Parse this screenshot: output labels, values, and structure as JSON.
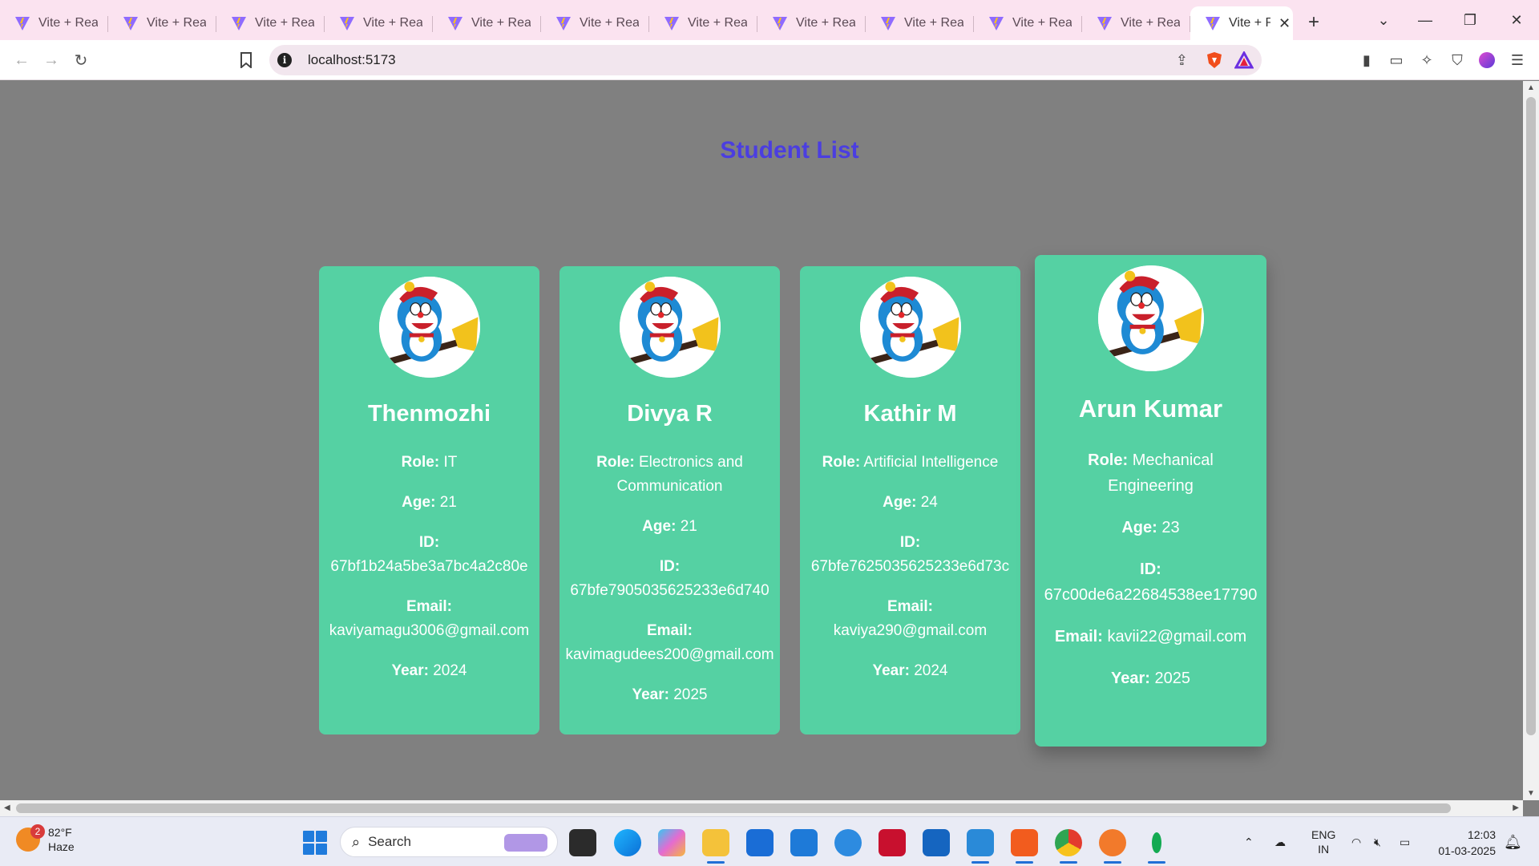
{
  "browser": {
    "tabs": [
      {
        "title": "Vite + React"
      },
      {
        "title": "Vite + React"
      },
      {
        "title": "Vite + React"
      },
      {
        "title": "Vite + React"
      },
      {
        "title": "Vite + React"
      },
      {
        "title": "Vite + React"
      },
      {
        "title": "Vite + React"
      },
      {
        "title": "Vite + React"
      },
      {
        "title": "Vite + React"
      },
      {
        "title": "Vite + React"
      },
      {
        "title": "Vite + React"
      }
    ],
    "active_tab": {
      "title": "Vite + React"
    },
    "address": "localhost:5173",
    "icons": [
      "back-icon",
      "forward-icon",
      "reload-icon",
      "bookmark-icon",
      "site-info-icon",
      "share-icon",
      "brave-shields-icon",
      "brave-rewards-icon",
      "sidebar-icon",
      "wallet-icon",
      "leo-ai-icon",
      "vpn-icon",
      "profile-icon",
      "menu-icon"
    ]
  },
  "page": {
    "heading": "Student List",
    "heading_color": "#4b3ee0",
    "card_color": "#55d1a3",
    "labels": {
      "role": "Role:",
      "age": "Age:",
      "id": "ID:",
      "email": "Email:",
      "year": "Year:"
    },
    "students": [
      {
        "name": "Thenmozhi",
        "role": "IT",
        "age": "21",
        "id": "67bf1b24a5be3a7bc4a2c80e",
        "email": "kaviyamagu3006@gmail.com",
        "year": "2024"
      },
      {
        "name": "Divya R",
        "role": "Electronics and Communication",
        "age": "21",
        "id": "67bfe7905035625233e6d740",
        "email": "kavimagudees200@gmail.com",
        "year": "2025"
      },
      {
        "name": "Kathir M",
        "role": "Artificial Intelligence",
        "age": "24",
        "id": "67bfe7625035625233e6d73c",
        "email": "kaviya290@gmail.com",
        "year": "2024"
      },
      {
        "name": "Arun Kumar",
        "role": "Mechanical Engineering",
        "age": "23",
        "id": "67c00de6a22684538ee17790",
        "email": "kavii22@gmail.com",
        "year": "2025"
      }
    ]
  },
  "taskbar": {
    "weather": {
      "temp": "82°F",
      "condition": "Haze",
      "badge": "2"
    },
    "search_label": "Search",
    "tray": {
      "lang_line1": "ENG",
      "lang_line2": "IN"
    },
    "clock": {
      "time": "12:03",
      "date": "01-03-2025"
    }
  }
}
